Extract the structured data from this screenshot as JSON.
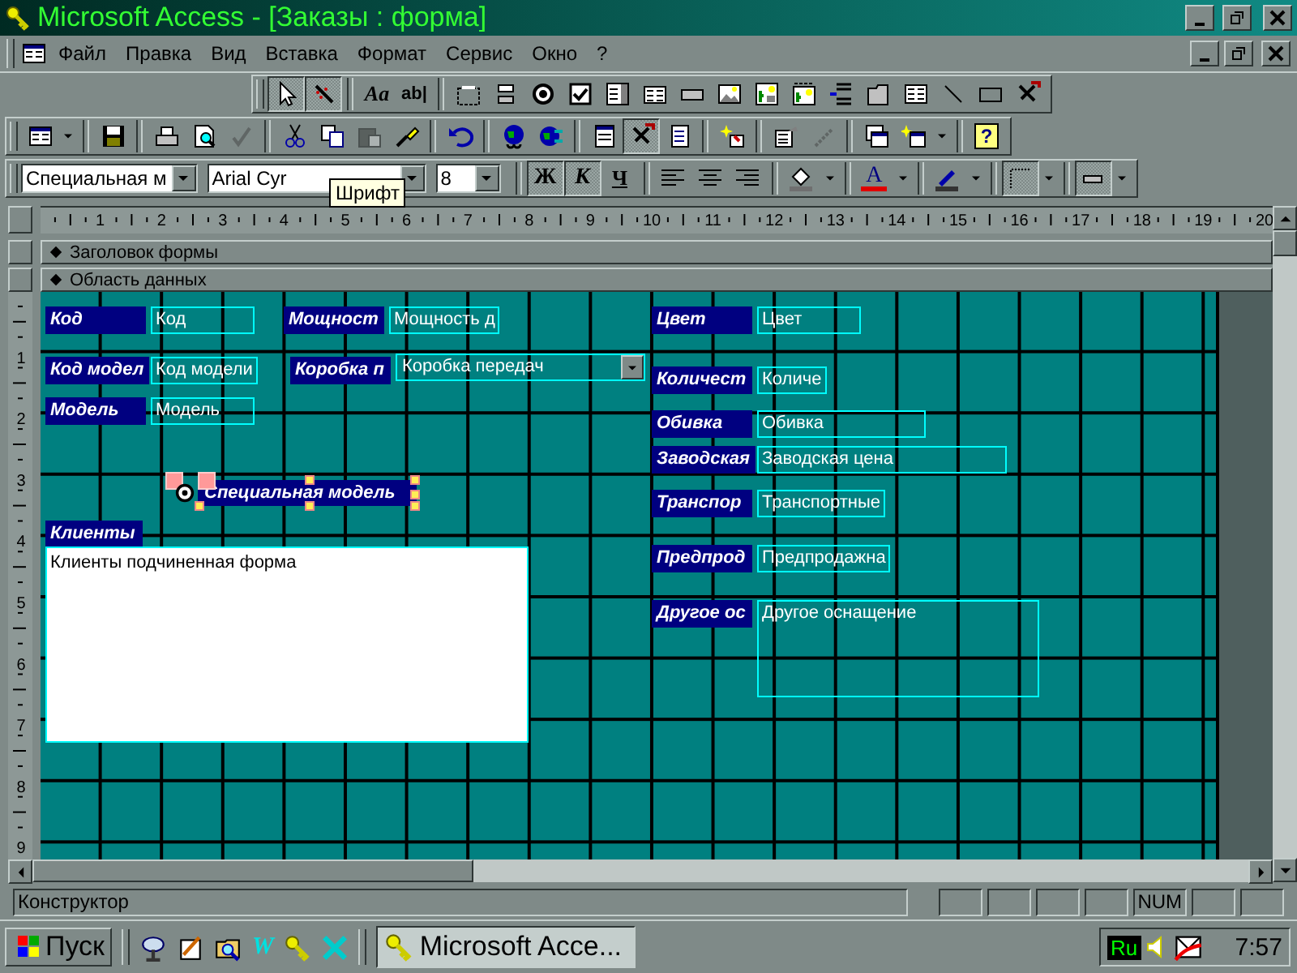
{
  "window": {
    "title": "Microsoft Access - [Заказы : форма]"
  },
  "menu": [
    {
      "label": "Файл"
    },
    {
      "label": "Правка"
    },
    {
      "label": "Вид"
    },
    {
      "label": "Вставка"
    },
    {
      "label": "Формат"
    },
    {
      "label": "Сервис"
    },
    {
      "label": "Окно"
    },
    {
      "label": "?"
    }
  ],
  "toolbox": {
    "groups": [
      [
        {
          "kind": "pointer",
          "pressed": true
        },
        {
          "kind": "wand",
          "pressed": true
        }
      ],
      [
        {
          "kind": "label_tool",
          "label": "Aa",
          "pressed": false
        },
        {
          "kind": "textbox_tool",
          "label": "ab|",
          "pressed": false
        }
      ],
      [
        {
          "kind": "option_group",
          "pressed": false
        },
        {
          "kind": "toggle",
          "pressed": false
        },
        {
          "kind": "option",
          "pressed": false
        },
        {
          "kind": "check"
        },
        {
          "kind": "combo_tool",
          "pressed": false
        },
        {
          "kind": "list",
          "pressed": false
        },
        {
          "kind": "command",
          "pressed": false
        },
        {
          "kind": "image",
          "pressed": false
        },
        {
          "kind": "unbound",
          "pressed": false
        },
        {
          "kind": "bound",
          "pressed": false
        },
        {
          "kind": "pagebreak",
          "pressed": false
        },
        {
          "kind": "tab",
          "pressed": false
        },
        {
          "kind": "subform",
          "pressed": false
        },
        {
          "kind": "line",
          "pressed": false
        },
        {
          "kind": "rect",
          "pressed": false
        },
        {
          "kind": "more",
          "pressed": false
        }
      ]
    ]
  },
  "standard": {
    "groups": [
      [
        {
          "kind": "form_view",
          "pressed": false,
          "disabled": false
        },
        {
          "kind": "caret",
          "pressed": false,
          "disabled": false
        }
      ],
      [
        {
          "kind": "save",
          "pressed": false,
          "disabled": false
        }
      ],
      [
        {
          "kind": "print",
          "pressed": false,
          "disabled": false
        },
        {
          "kind": "preview",
          "pressed": false,
          "disabled": false
        },
        {
          "kind": "spelling",
          "pressed": false,
          "disabled": true
        }
      ],
      [
        {
          "kind": "cut",
          "pressed": false,
          "disabled": false
        },
        {
          "kind": "copy",
          "pressed": false,
          "disabled": false
        },
        {
          "kind": "paste",
          "pressed": false,
          "disabled": true
        },
        {
          "kind": "painter",
          "pressed": false,
          "disabled": false
        }
      ],
      [
        {
          "kind": "undo",
          "pressed": false,
          "disabled": false
        }
      ],
      [
        {
          "kind": "hyperlink",
          "pressed": false,
          "disabled": false
        },
        {
          "kind": "web",
          "pressed": false,
          "disabled": false
        }
      ],
      [
        {
          "kind": "field_list",
          "pressed": false,
          "disabled": false
        },
        {
          "kind": "toolbox",
          "pressed": true,
          "disabled": false
        },
        {
          "kind": "code",
          "pressed": false,
          "disabled": false
        }
      ],
      [
        {
          "kind": "autoformat",
          "pressed": false,
          "disabled": false
        }
      ],
      [
        {
          "kind": "properties",
          "pressed": false,
          "disabled": false
        },
        {
          "kind": "build",
          "pressed": false,
          "disabled": true
        }
      ],
      [
        {
          "kind": "database",
          "pressed": false,
          "disabled": false
        },
        {
          "kind": "new_object",
          "pressed": false,
          "disabled": false
        },
        {
          "kind": "caret",
          "pressed": false,
          "disabled": false
        }
      ],
      [
        {
          "kind": "help",
          "label": "?",
          "pressed": false,
          "disabled": false
        }
      ]
    ]
  },
  "formatting": {
    "groups": [
      [
        {
          "kind": "combo",
          "value": "Специальная м"
        },
        {
          "kind": "combo",
          "value": "Arial Cyr"
        },
        {
          "kind": "combo",
          "value": "8"
        }
      ],
      [
        {
          "kind": "bold",
          "label": "Ж",
          "pressed": true
        },
        {
          "kind": "italic",
          "label": "К",
          "pressed": true
        },
        {
          "kind": "underline",
          "label": "Ч",
          "pressed": false
        }
      ],
      [
        {
          "kind": "align_left",
          "pressed": false
        },
        {
          "kind": "align_center",
          "pressed": false
        },
        {
          "kind": "align_right",
          "pressed": false
        }
      ],
      [
        {
          "kind": "fill_color",
          "pressed": false
        },
        {
          "kind": "caret",
          "pressed": false
        }
      ],
      [
        {
          "kind": "font_color",
          "label": "A",
          "pressed": false
        },
        {
          "kind": "caret",
          "pressed": false
        }
      ],
      [
        {
          "kind": "line_color",
          "pressed": false
        },
        {
          "kind": "caret",
          "pressed": false
        }
      ],
      [
        {
          "kind": "border_width",
          "pressed": true
        },
        {
          "kind": "caret",
          "pressed": false
        }
      ],
      [
        {
          "kind": "effect",
          "pressed": true
        },
        {
          "kind": "caret",
          "pressed": false
        }
      ]
    ]
  },
  "tooltip": "Шрифт",
  "ruler": {
    "horizontal": [
      "1",
      "2",
      "3",
      "4",
      "5",
      "6",
      "7",
      "8",
      "9",
      "10",
      "11",
      "12",
      "13",
      "14",
      "15",
      "16",
      "17",
      "18",
      "19",
      "20"
    ],
    "vertical": [
      "1",
      "2",
      "3",
      "4",
      "5",
      "6",
      "7",
      "8",
      "9"
    ]
  },
  "sections": [
    {
      "title": "Заголовок формы"
    },
    {
      "title": "Область данных"
    }
  ],
  "form": {
    "controls": [
      {
        "kind": "label",
        "text": "Код",
        "selected": false
      },
      {
        "kind": "textbox",
        "text": "Код",
        "selected": false
      },
      {
        "kind": "label",
        "text": "Мощност",
        "selected": false
      },
      {
        "kind": "textbox",
        "text": "Мощность д",
        "selected": false
      },
      {
        "kind": "label",
        "text": "Цвет",
        "selected": false
      },
      {
        "kind": "textbox",
        "text": "Цвет",
        "selected": false
      },
      {
        "kind": "label",
        "text": "Код модел",
        "selected": false
      },
      {
        "kind": "textbox",
        "text": "Код модели",
        "selected": false
      },
      {
        "kind": "label",
        "text": "Коробка п",
        "selected": false
      },
      {
        "kind": "combo",
        "text": "Коробка передач",
        "selected": false
      },
      {
        "kind": "label",
        "text": "Количест",
        "selected": false
      },
      {
        "kind": "textbox",
        "text": "Количе",
        "selected": false
      },
      {
        "kind": "label",
        "text": "Модель",
        "selected": false
      },
      {
        "kind": "textbox",
        "text": "Модель",
        "selected": false
      },
      {
        "kind": "label",
        "text": "Обивка",
        "selected": false
      },
      {
        "kind": "textbox",
        "text": "Обивка",
        "selected": false
      },
      {
        "kind": "label",
        "text": "Заводская",
        "selected": false
      },
      {
        "kind": "textbox",
        "text": "Заводская цена",
        "selected": false
      },
      {
        "kind": "option_label",
        "text": "Специальная модель",
        "selected": true
      },
      {
        "kind": "label",
        "text": "Транспор",
        "selected": false
      },
      {
        "kind": "textbox",
        "text": "Транспортные",
        "selected": false
      },
      {
        "kind": "label",
        "text": "Клиенты",
        "selected": false
      },
      {
        "kind": "subform",
        "text": "Клиенты подчиненная форма",
        "selected": false
      },
      {
        "kind": "label",
        "text": "Предпрод",
        "selected": false
      },
      {
        "kind": "textbox",
        "text": "Предпродажна",
        "selected": false
      },
      {
        "kind": "label",
        "text": "Другое ос",
        "selected": false
      },
      {
        "kind": "memo",
        "text": "Другое оснащение",
        "selected": false
      }
    ]
  },
  "status_bar": {
    "text": "Конструктор",
    "indicators": [
      {
        "text": "NUM"
      }
    ]
  },
  "taskbar": {
    "start": "Пуск",
    "quick_launch": [
      {
        "kind": "dish"
      },
      {
        "kind": "notepad"
      },
      {
        "kind": "search_folder"
      },
      {
        "kind": "word",
        "label": "W"
      },
      {
        "kind": "key"
      },
      {
        "kind": "excel"
      }
    ],
    "tasks": [
      {
        "title": "Microsoft Acce...",
        "selected": true
      }
    ],
    "language": "Ru",
    "time": "7:57"
  }
}
